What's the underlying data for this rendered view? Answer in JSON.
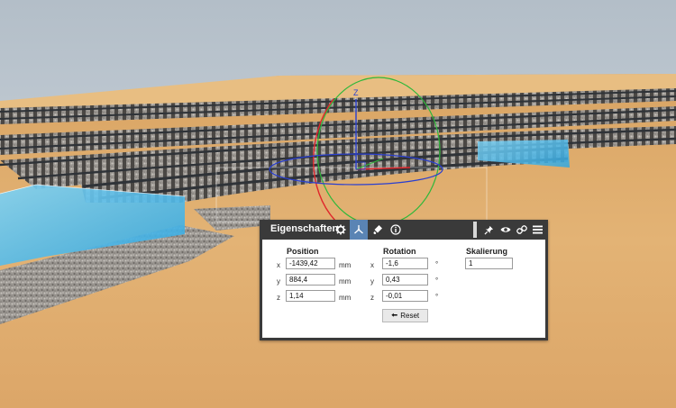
{
  "panel": {
    "title": "Eigenschaften",
    "tabs": [
      {
        "icon": "gear-icon"
      },
      {
        "icon": "transform-icon",
        "active": true
      },
      {
        "icon": "paint-icon"
      },
      {
        "icon": "info-icon"
      }
    ],
    "tools": [
      "pin-icon",
      "eye-icon",
      "link-icon",
      "menu-icon"
    ]
  },
  "position": {
    "header": "Position",
    "x": {
      "axis": "x",
      "value": "-1439,42",
      "unit": "mm"
    },
    "y": {
      "axis": "y",
      "value": "884,4",
      "unit": "mm"
    },
    "z": {
      "axis": "z",
      "value": "1,14",
      "unit": "mm"
    }
  },
  "rotation": {
    "header": "Rotation",
    "x": {
      "axis": "x",
      "value": "-1,6",
      "unit": "°"
    },
    "y": {
      "axis": "y",
      "value": "0,43",
      "unit": "°"
    },
    "z": {
      "axis": "z",
      "value": "-0,01",
      "unit": "°"
    }
  },
  "scale": {
    "header": "Skalierung",
    "value": "1"
  },
  "reset_label": "Reset",
  "gizmo": {
    "axis_label": "Z"
  },
  "colors": {
    "selection": "#4ab8ea",
    "panel_header": "#3a3a3a",
    "active_tab": "#5a84b4"
  }
}
